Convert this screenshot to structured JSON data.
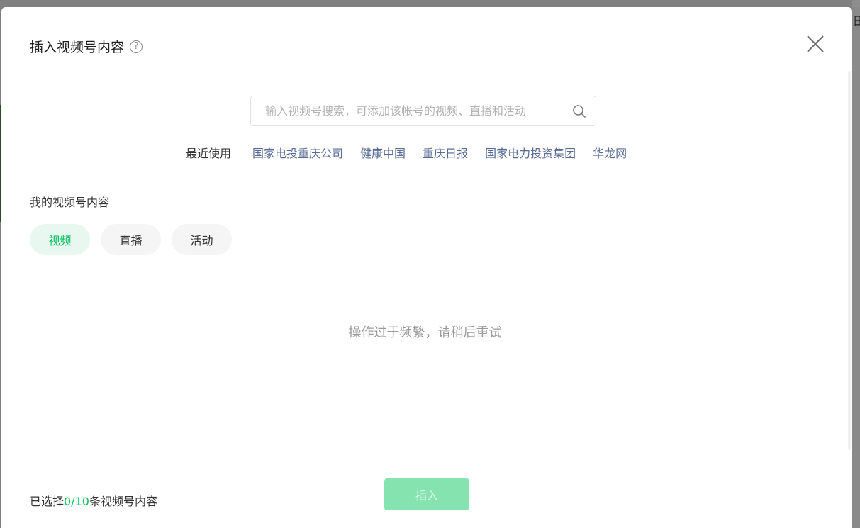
{
  "dialog": {
    "title": "插入视频号内容",
    "help_icon": "question-circle-icon",
    "close_icon": "close-icon"
  },
  "search": {
    "placeholder": "输入视频号搜索，可添加该帐号的视频、直播和活动",
    "icon": "search-icon"
  },
  "recent": {
    "label": "最近使用",
    "items": [
      "国家电投重庆公司",
      "健康中国",
      "重庆日报",
      "国家电力投资集团",
      "华龙网"
    ]
  },
  "my_content": {
    "title": "我的视频号内容",
    "tabs": [
      {
        "label": "视频",
        "active": true
      },
      {
        "label": "直播",
        "active": false
      },
      {
        "label": "活动",
        "active": false
      }
    ],
    "empty_message": "操作过于频繁，请稍后重试"
  },
  "footer": {
    "selected_prefix": "已选择",
    "selected_count": "0/10",
    "selected_suffix": "条视频号内容",
    "insert_label": "插入"
  },
  "colors": {
    "accent": "#07c160",
    "link": "#576b95",
    "insert_disabled_bg": "#85e3b0"
  },
  "backdrop": {
    "edge_glyph": "田"
  }
}
